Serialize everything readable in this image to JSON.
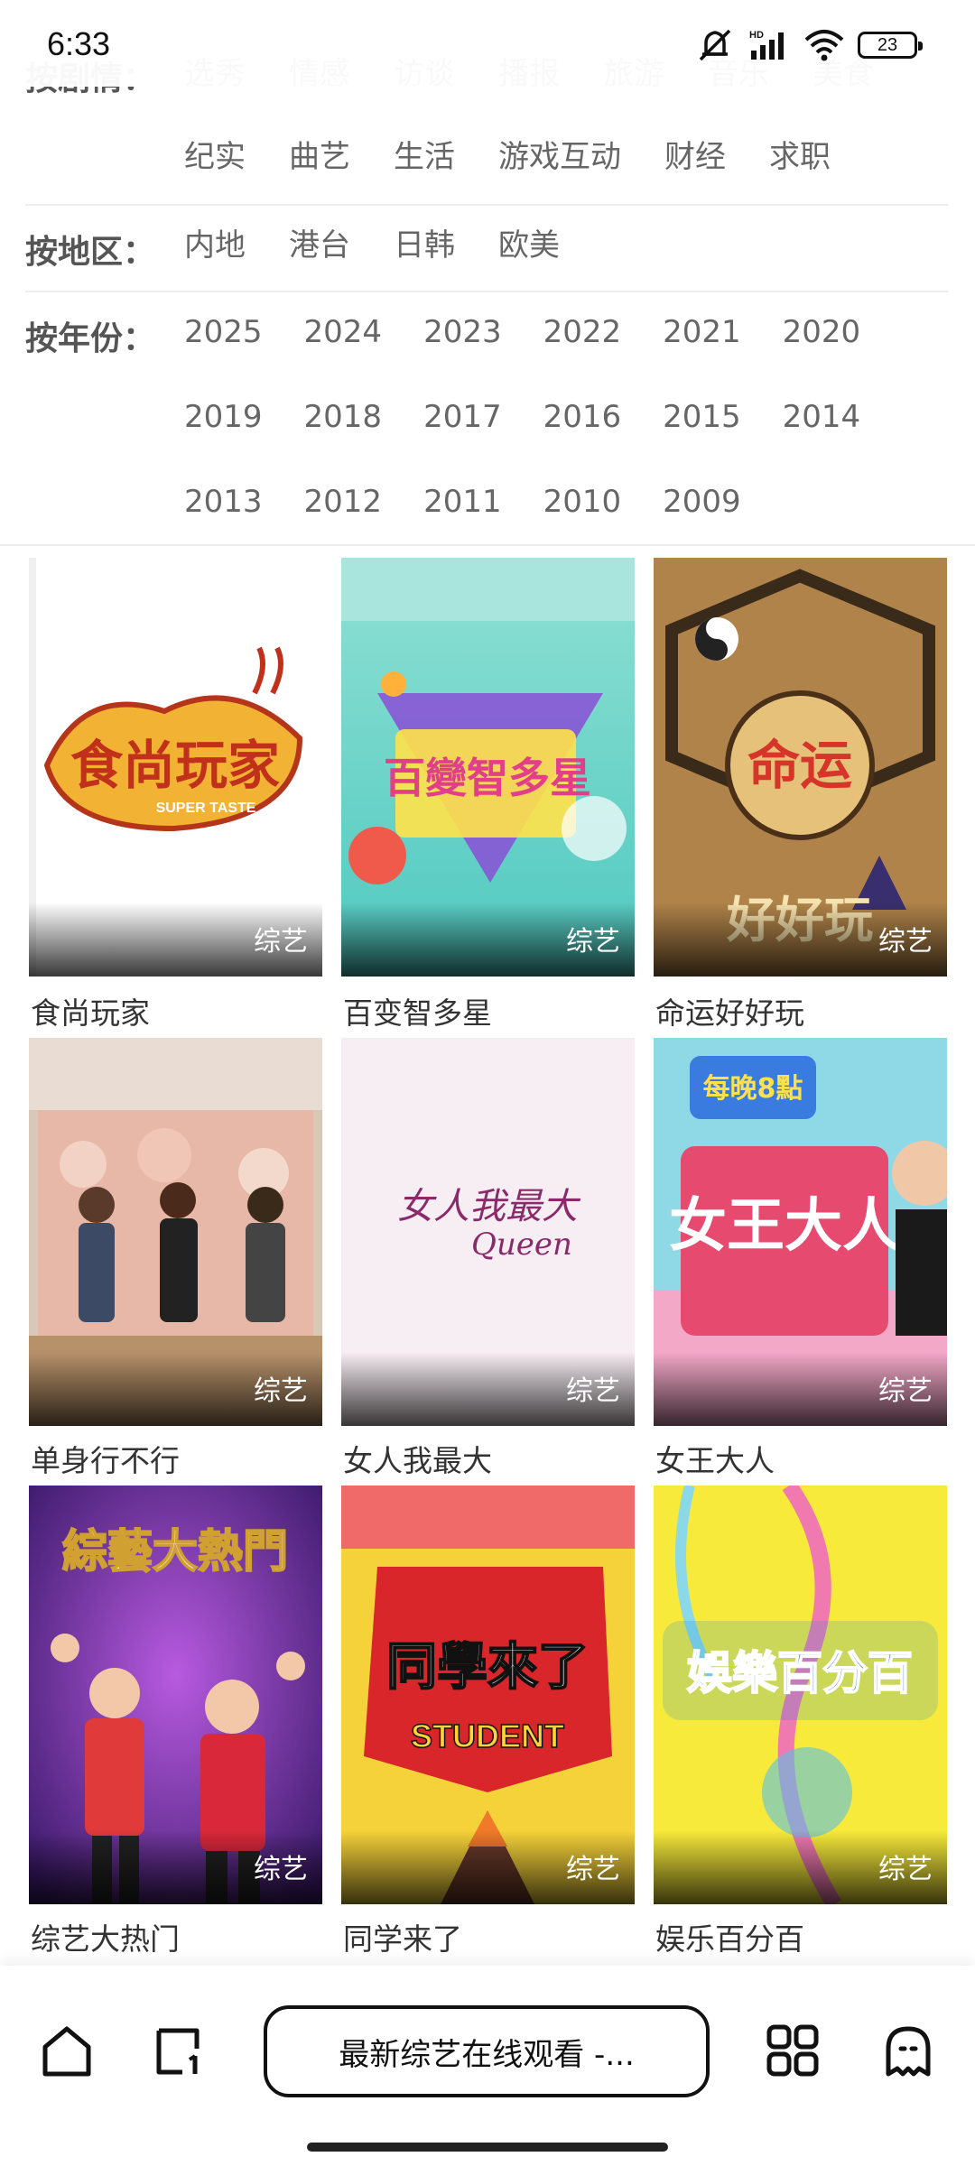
{
  "status_bar": {
    "time": "6:33",
    "battery": "23",
    "network_label": "HD"
  },
  "filters": {
    "plot": {
      "label": "按剧情：",
      "items_row1": [
        "选秀",
        "情感",
        "访谈",
        "播报",
        "旅游",
        "音乐",
        "美食"
      ],
      "items_row2": [
        "纪实",
        "曲艺",
        "生活",
        "游戏互动",
        "财经",
        "求职"
      ]
    },
    "region": {
      "label": "按地区：",
      "items": [
        "内地",
        "港台",
        "日韩",
        "欧美"
      ]
    },
    "year": {
      "label": "按年份：",
      "items": [
        "2025",
        "2024",
        "2023",
        "2022",
        "2021",
        "2020",
        "2019",
        "2018",
        "2017",
        "2016",
        "2015",
        "2014",
        "2013",
        "2012",
        "2011",
        "2010",
        "2009"
      ]
    }
  },
  "shows": [
    {
      "title": "食尚玩家",
      "tag": "综艺",
      "poster_text": "食尚玩家",
      "poster_sub": "SUPER TASTE"
    },
    {
      "title": "百变智多星",
      "tag": "综艺",
      "poster_text": "百變智多星",
      "poster_sub": ""
    },
    {
      "title": "命运好好玩",
      "tag": "综艺",
      "poster_text": "命运",
      "poster_sub": "好好玩"
    },
    {
      "title": "单身行不行",
      "tag": "综艺",
      "poster_text": "",
      "poster_sub": ""
    },
    {
      "title": "女人我最大",
      "tag": "综艺",
      "poster_text": "女人我最大",
      "poster_sub": "Queen"
    },
    {
      "title": "女王大人",
      "tag": "综艺",
      "poster_text": "女王大人",
      "poster_sub": "每晚8點"
    },
    {
      "title": "综艺大热门",
      "tag": "综艺",
      "poster_text": "綜藝大熱門",
      "poster_sub": ""
    },
    {
      "title": "同学来了",
      "tag": "综艺",
      "poster_text": "同學來了",
      "poster_sub": "STUDENT"
    },
    {
      "title": "娱乐百分百",
      "tag": "综艺",
      "poster_text": "娛樂百分百",
      "poster_sub": ""
    }
  ],
  "bottom_nav": {
    "url_text": "最新综艺在线观看 -..."
  },
  "colors": {
    "accent_text": "#333333",
    "muted_text": "#666666",
    "divider": "#eeeeee"
  }
}
